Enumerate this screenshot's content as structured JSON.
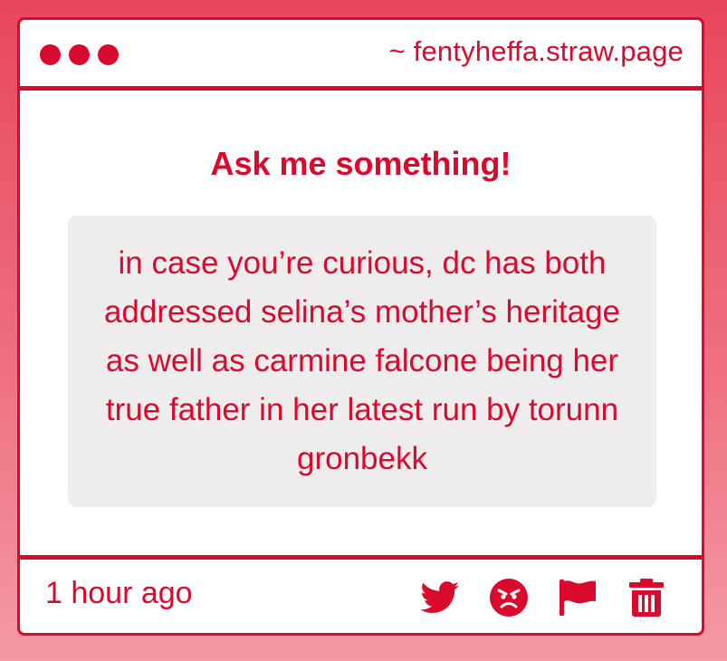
{
  "window": {
    "url": "~ fentyheffa.straw.page"
  },
  "main": {
    "heading": "Ask me something!",
    "question": "in case you’re curious, dc has both addressed selina’s mother’s heritage as well as carmine falcone being her true father in her latest run by torunn gronbekk"
  },
  "footer": {
    "timestamp": "1 hour ago",
    "actions": [
      {
        "icon": "twitter-icon"
      },
      {
        "icon": "angry-face-icon"
      },
      {
        "icon": "flag-icon"
      },
      {
        "icon": "trash-icon"
      }
    ]
  },
  "colors": {
    "accent": "#d90a2c",
    "question_bg": "#eeecec",
    "page_gradient_top": "#e8475e",
    "page_gradient_bottom": "#f49aa5"
  }
}
